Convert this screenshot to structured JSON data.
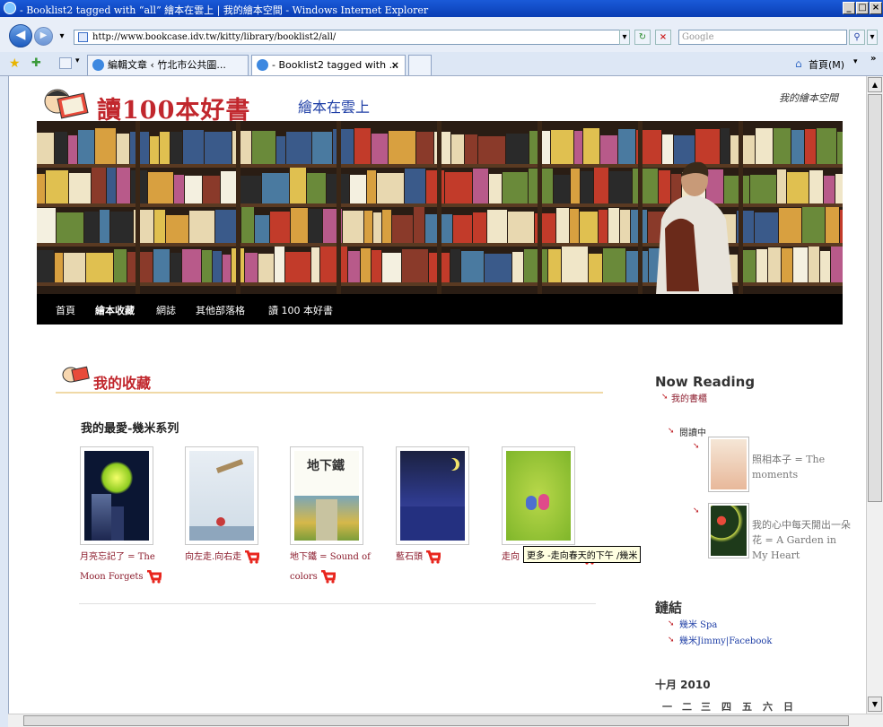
{
  "window": {
    "title": "- Booklist2 tagged with “all” 繪本在雲上 | 我的繪本空間 - Windows Internet Explorer"
  },
  "address_bar": {
    "url": "http://www.bookcase.idv.tw/kitty/library/booklist2/all/",
    "search_placeholder": "Google"
  },
  "tabs": [
    {
      "label": "編輯文章 ‹ 竹北市公共圖..."
    },
    {
      "label": "- Booklist2 tagged with ..."
    }
  ],
  "toolbar": {
    "home_label": "首頁(M)"
  },
  "site": {
    "logo": "讀100本好書",
    "subtitle": "繪本在雲上",
    "tagline": "我的繪本空間"
  },
  "nav": {
    "items": [
      "首頁",
      "繪本收藏",
      "網誌",
      "其他部落格",
      "讀 100 本好書"
    ]
  },
  "main": {
    "section_title": "我的收藏",
    "list_heading": "我的最愛-幾米系列",
    "books": [
      {
        "title_line1": "月亮忘記了 = The",
        "title_line2": "Moon Forgets"
      },
      {
        "title_line1": "向左走.向右走",
        "title_line2": ""
      },
      {
        "title_line1": "地下鐵 = Sound of",
        "title_line2": "colors"
      },
      {
        "title_line1": "藍石頭",
        "title_line2": ""
      },
      {
        "title_line1": "走向",
        "title_line2": ""
      }
    ],
    "tooltip": "更多 -走向春天的下午 /幾米"
  },
  "sidebar": {
    "now_reading_heading": "Now Reading",
    "bookshelf_link": "我的書櫃",
    "reading_label": "閱讀中",
    "reading_books": [
      {
        "title": "照相本子 = The moments"
      },
      {
        "title": "我的心中每天開出一朵花 = A Garden in My Heart"
      }
    ],
    "links_heading": "鏈結",
    "links": [
      "幾米 Spa",
      "幾米Jimmy|Facebook"
    ],
    "calendar_heading": "十月 2010",
    "calendar_days": [
      "一",
      "二",
      "三",
      "四",
      "五",
      "六",
      "日"
    ]
  },
  "colors": {
    "accent_red": "#c1272d",
    "link_blue": "#1f3fa6",
    "title_bar": "#0a3eb4"
  }
}
